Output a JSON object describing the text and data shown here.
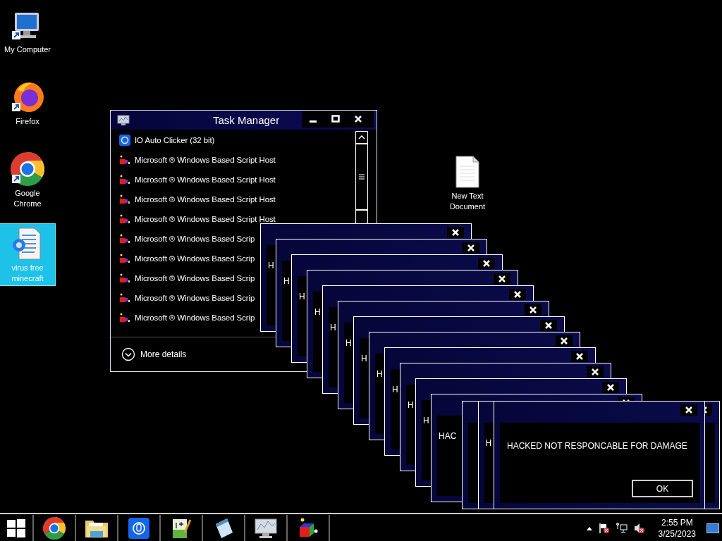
{
  "desktop_icons": [
    {
      "label": "My Computer",
      "kind": "computer",
      "selected": false
    },
    {
      "label": "Firefox",
      "kind": "firefox",
      "selected": false
    },
    {
      "label": "Google Chrome",
      "kind": "chrome",
      "selected": false
    },
    {
      "label": "virus free minecraft",
      "kind": "script",
      "selected": true
    },
    {
      "label": "New Text Document",
      "kind": "text",
      "selected": false
    }
  ],
  "task_manager": {
    "title": "Task Manager",
    "processes": [
      {
        "name": "IO Auto Clicker (32 bit)",
        "kind": "clicker"
      },
      {
        "name": "Microsoft ® Windows Based Script Host",
        "kind": "script"
      },
      {
        "name": "Microsoft ® Windows Based Script Host",
        "kind": "script"
      },
      {
        "name": "Microsoft ® Windows Based Script Host",
        "kind": "script"
      },
      {
        "name": "Microsoft ® Windows Based Script Host",
        "kind": "script"
      },
      {
        "name": "Microsoft ® Windows Based Scrip",
        "kind": "script"
      },
      {
        "name": "Microsoft ® Windows Based Scrip",
        "kind": "script"
      },
      {
        "name": "Microsoft ® Windows Based Scrip",
        "kind": "script"
      },
      {
        "name": "Microsoft ® Windows Based Scrip",
        "kind": "script"
      },
      {
        "name": "Microsoft ® Windows Based Scrip",
        "kind": "script"
      }
    ],
    "more_details": "More details"
  },
  "dialogs": [
    {
      "kind": "dialog",
      "message": "H"
    },
    {
      "kind": "dialog",
      "message": "H"
    },
    {
      "kind": "dialog",
      "message": "H"
    },
    {
      "kind": "dialog",
      "message": "H"
    },
    {
      "kind": "dialog",
      "message": "H"
    },
    {
      "kind": "dialog",
      "message": "H"
    },
    {
      "kind": "dialog",
      "message": "H"
    },
    {
      "kind": "dialog",
      "message": "H"
    },
    {
      "kind": "dialog",
      "message": "H"
    },
    {
      "kind": "dialog",
      "message": "H"
    },
    {
      "kind": "dialog",
      "message": "H"
    },
    {
      "kind": "dialog",
      "message": "HAC"
    },
    {
      "kind": "dialog"
    },
    {
      "kind": "dialog",
      "message": "H"
    },
    {
      "kind": "dialog",
      "message": "HACKED NOT RESPONCABLE FOR DAMAGE",
      "button": "OK"
    }
  ],
  "taskbar": {
    "apps": [
      {
        "kind": "chrome"
      },
      {
        "kind": "folder"
      },
      {
        "kind": "clicker"
      },
      {
        "kind": "notepadpp"
      },
      {
        "kind": "notepad"
      },
      {
        "kind": "taskmgr"
      },
      {
        "kind": "cube"
      }
    ],
    "clock": {
      "time": "2:55 PM",
      "date": "3/25/2023"
    }
  }
}
